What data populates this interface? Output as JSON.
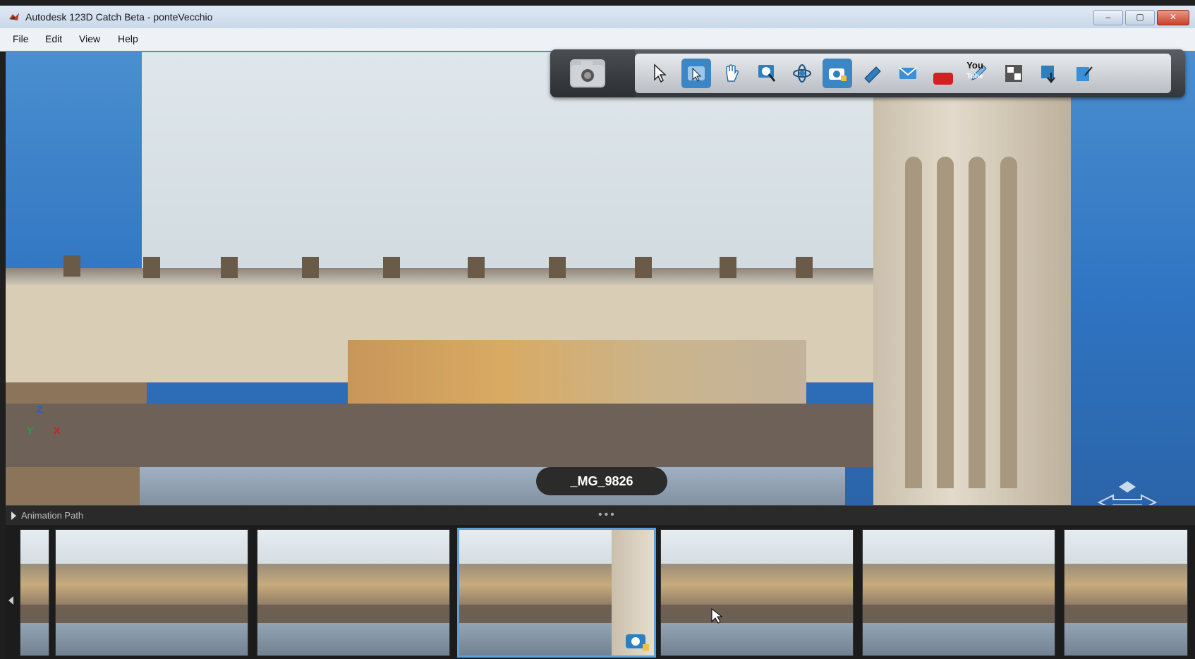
{
  "window": {
    "title": "Autodesk 123D Catch Beta - ponteVecchio",
    "controls": [
      "–",
      "▢",
      "✕"
    ]
  },
  "menu": {
    "items": [
      "File",
      "Edit",
      "View",
      "Help"
    ]
  },
  "toolbar": {
    "tools": [
      {
        "name": "select-icon",
        "glyph": "↖",
        "active": false
      },
      {
        "name": "select-photo-icon",
        "glyph": "↖",
        "active": true
      },
      {
        "name": "pan-icon",
        "glyph": "✋",
        "active": false
      },
      {
        "name": "zoom-icon",
        "glyph": "🔍",
        "active": false
      },
      {
        "name": "orbit-icon",
        "glyph": "✣",
        "active": false
      },
      {
        "name": "camera-view-icon",
        "glyph": "📷",
        "active": true
      },
      {
        "name": "measure-icon",
        "glyph": "◆",
        "active": false
      },
      {
        "name": "email-icon",
        "glyph": "✉",
        "active": false
      },
      {
        "name": "youtube-icon",
        "glyph": "You",
        "active": false
      },
      {
        "name": "pen-icon",
        "glyph": "✎",
        "active": false
      },
      {
        "name": "export-icon",
        "glyph": "⇥",
        "active": false
      },
      {
        "name": "download-icon",
        "glyph": "⬇",
        "active": false
      },
      {
        "name": "edit-icon",
        "glyph": "✐",
        "active": false
      }
    ],
    "brand": {
      "you": "You",
      "tube": "Tube"
    }
  },
  "viewport": {
    "axis": {
      "z": "Z",
      "x": "X",
      "y": "Y"
    },
    "photo_label": "_MG_9826"
  },
  "animation_bar": {
    "label": "Animation Path",
    "dots": "•••"
  },
  "filmstrip": {
    "thumbnails": [
      {
        "selected": false
      },
      {
        "selected": false
      },
      {
        "selected": false
      },
      {
        "selected": true
      },
      {
        "selected": false
      },
      {
        "selected": false
      },
      {
        "selected": false
      }
    ]
  },
  "colors": {
    "accent": "#3d86c6",
    "viewport_bg": "#3a7fc6"
  }
}
